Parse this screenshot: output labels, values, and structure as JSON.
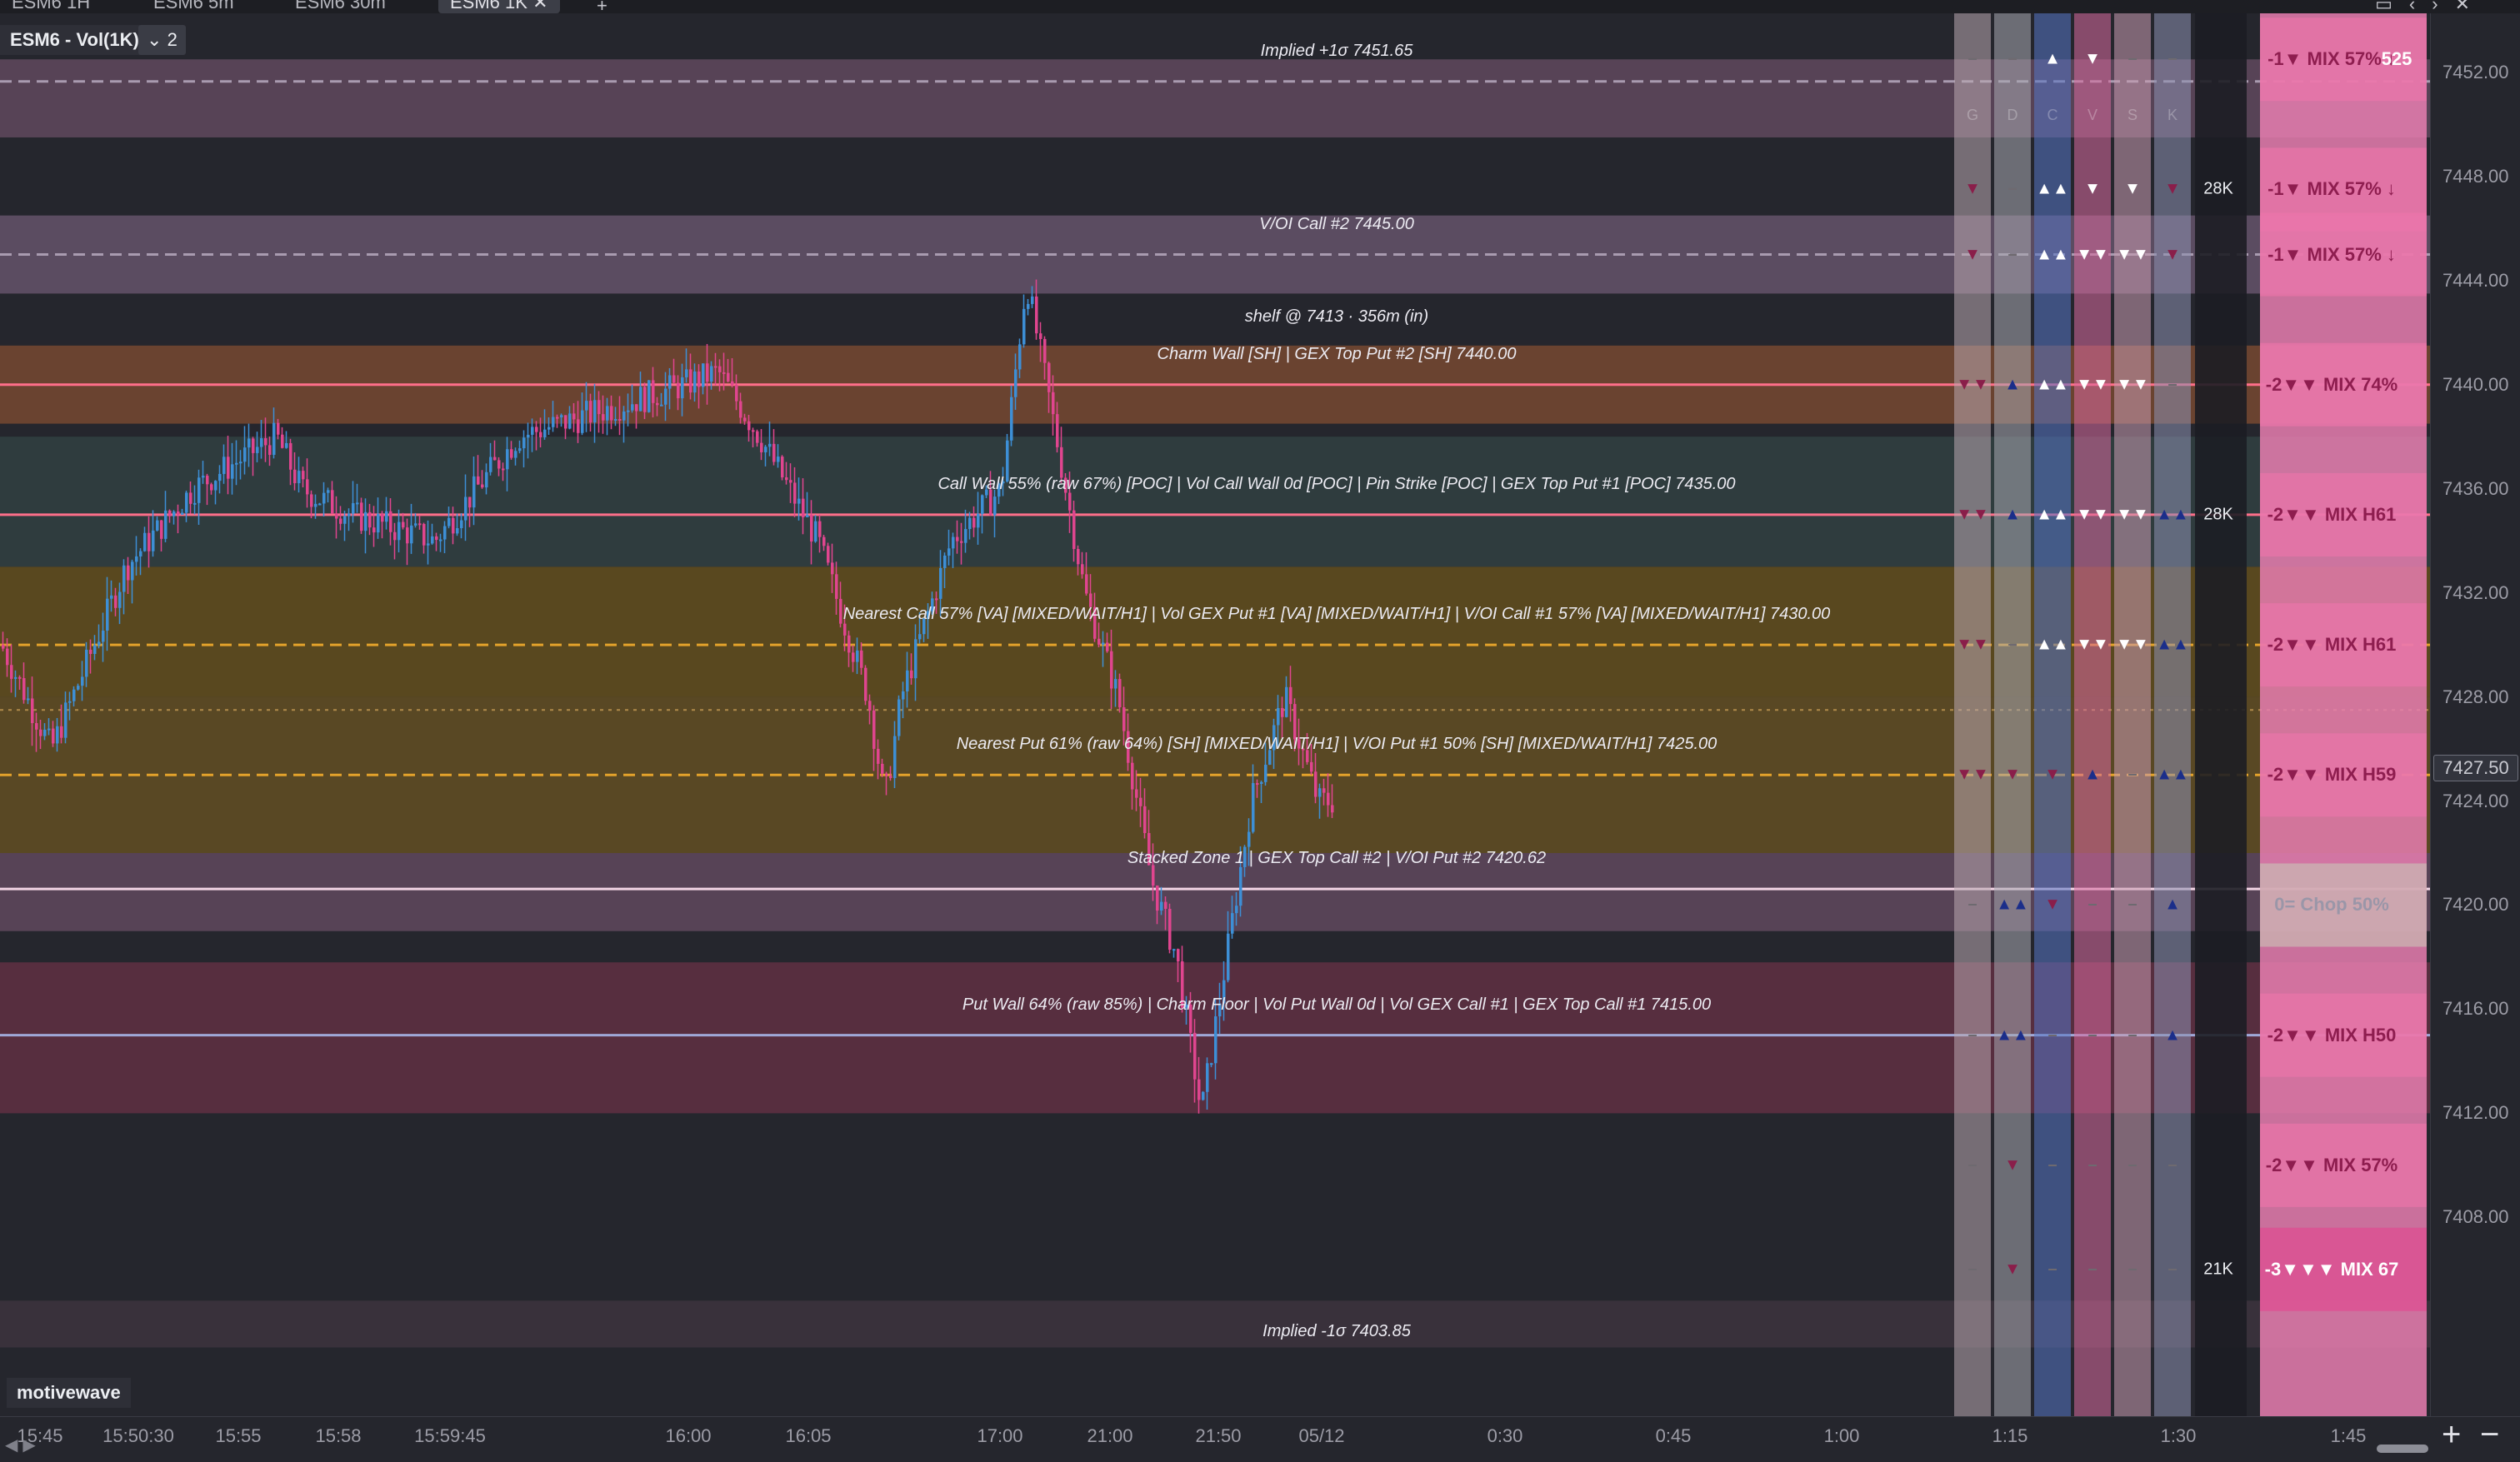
{
  "tabs": [
    {
      "label": "ESM6 1H",
      "active": false
    },
    {
      "label": "ESM6 5m",
      "active": false
    },
    {
      "label": "ESM6 30m",
      "active": false
    },
    {
      "label": "ESM6 1K",
      "active": true
    }
  ],
  "chart": {
    "symbol_label": "ESM6 - Vol(1K)",
    "layer_count": "2",
    "watermark": "motivewave",
    "current_price": "7427.50"
  },
  "colors": {
    "background": "#25262d",
    "candle_up": "#3d8fd6",
    "candle_down": "#e0458f",
    "call_line": "#ff6f8a",
    "nearest_line": "#e3a22b",
    "band_purple": "#5a4458",
    "band_orange": "#6e4530",
    "band_teal": "#2f3d3f",
    "band_gold": "#5c4a1f",
    "band_red": "#5a2e40"
  },
  "price_axis": {
    "min": 7401,
    "max": 7453.5,
    "ticks": [
      "7452.00",
      "7448.00",
      "7444.00",
      "7440.00",
      "7436.00",
      "7432.00",
      "7428.00",
      "7424.00",
      "7420.00",
      "7416.00",
      "7412.00",
      "7408.00"
    ]
  },
  "time_axis": {
    "labels": [
      "15:45",
      "15:50:30",
      "15:55",
      "15:58",
      "15:59:45",
      "16:00",
      "16:05",
      "17:00",
      "21:00",
      "21:50",
      "05/12",
      "0:30",
      "0:45",
      "1:00",
      "1:15",
      "1:30",
      "1:45"
    ]
  },
  "bands": [
    {
      "label": "Implied +1σ  7451.65",
      "price": 7451.65,
      "top": 7452.5,
      "bottom": 7449.5,
      "color": "#5a4458",
      "line": "#a99bb0",
      "dashed": true
    },
    {
      "label": "V/OI Call #2  7445.00",
      "price": 7445.0,
      "top": 7446.5,
      "bottom": 7443.5,
      "color": "#5e4e64",
      "line": "#a99bb0",
      "dashed": true
    },
    {
      "label": "shelf @ 7413 · 356m (in)",
      "price": 7442.6,
      "top": null,
      "bottom": null,
      "color": null,
      "line": null,
      "dashed": false
    },
    {
      "label": "Charm Wall [SH] | GEX Top Put #2 [SH]  7440.00",
      "price": 7440.0,
      "top": 7441.5,
      "bottom": 7438.5,
      "color": "#6e4530",
      "line": "#ff6f8a",
      "dashed": false
    },
    {
      "label": "Call Wall 55% (raw 67%) [POC] | Vol Call Wall 0d [POC] | Pin Strike [POC] | GEX Top Put #1 [POC]  7435.00",
      "price": 7435.0,
      "top": 7438.0,
      "bottom": 7433.0,
      "color": "#2f3d3f",
      "line": "#ff6f8a",
      "dashed": false
    },
    {
      "label": "Nearest Call 57% [VA] [MIXED/WAIT/H1] | Vol GEX Put #1 [VA] [MIXED/WAIT/H1] | V/OI Call #1 57% [VA] [MIXED/WAIT/H1]  7430.00",
      "price": 7430.0,
      "top": 7433.0,
      "bottom": 7428.0,
      "color": "#5c4a1f",
      "line": "#e3a22b",
      "dashed": true
    },
    {
      "label": "Nearest Put 61% (raw 64%) [SH] [MIXED/WAIT/H1] | V/OI Put #1 50% [SH] [MIXED/WAIT/H1]  7425.00",
      "price": 7425.0,
      "top": 7428.0,
      "bottom": 7422.0,
      "color": "#5c4a24",
      "line": "#e3a22b",
      "dashed": true
    },
    {
      "label": "Stacked Zone 1 | GEX Top Call #2 | V/OI Put #2  7420.62",
      "price": 7420.62,
      "top": 7422.0,
      "bottom": 7419.0,
      "color": "#5a4458",
      "line": "#f2d4e4",
      "dashed": false
    },
    {
      "label": "Put Wall 64% (raw 85%) | Charm Floor | Vol Put Wall 0d | Vol GEX Call #1 | GEX Top Call #1  7415.00",
      "price": 7415.0,
      "top": 7417.8,
      "bottom": 7412.0,
      "color": "#5a2e40",
      "line": "#9fa8d8",
      "dashed": false
    },
    {
      "label": "Implied -1σ  7403.85",
      "price": 7403.85,
      "top": 7404.8,
      "bottom": 7403.0,
      "color": "#3a323c",
      "line": null,
      "dashed": false
    }
  ],
  "matrix": {
    "columns": [
      "G",
      "D",
      "C",
      "V",
      "S",
      "K"
    ],
    "rows": [
      {
        "price": 7452.5,
        "cells": [
          "–",
          "–",
          "▲",
          "▼",
          "–",
          "–"
        ],
        "vol": "",
        "mix": "-1▼ MIX 57% ↓",
        "mix_extra": "525"
      },
      {
        "price": 7447.5,
        "cells": [
          "▼",
          "–",
          "▲▲",
          "▼",
          "▼",
          "▼"
        ],
        "vol": "28K",
        "mix": "-1▼ MIX 57% ↓",
        "mix_extra": ""
      },
      {
        "price": 7445.0,
        "cells": [
          "▼",
          "–",
          "▲▲",
          "▼▼",
          "▼▼",
          "▼"
        ],
        "vol": "",
        "mix": "-1▼ MIX 57% ↓",
        "mix_extra": ""
      },
      {
        "price": 7440.0,
        "cells": [
          "▼▼",
          "▲",
          "▲▲",
          "▼▼",
          "▼▼",
          "–"
        ],
        "vol": "",
        "mix": "-2▼▼ MIX 74%",
        "mix_extra": ""
      },
      {
        "price": 7435.0,
        "cells": [
          "▼▼",
          "▲",
          "▲▲",
          "▼▼",
          "▼▼",
          "▲▲"
        ],
        "vol": "28K",
        "mix": "-2▼▼ MIX H61",
        "mix_extra": ""
      },
      {
        "price": 7430.0,
        "cells": [
          "▼▼",
          "–",
          "▲▲",
          "▼▼",
          "▼▼",
          "▲▲"
        ],
        "vol": "",
        "mix": "-2▼▼ MIX H61",
        "mix_extra": ""
      },
      {
        "price": 7425.0,
        "cells": [
          "▼▼",
          "▼",
          "▼",
          "▲",
          "–",
          "▲▲"
        ],
        "vol": "",
        "mix": "-2▼▼ MIX H59",
        "mix_extra": ""
      },
      {
        "price": 7420.0,
        "cells": [
          "–",
          "▲▲",
          "▼",
          "–",
          "–",
          "▲"
        ],
        "vol": "",
        "mix": "0= Chop 50%",
        "mix_extra": ""
      },
      {
        "price": 7415.0,
        "cells": [
          "–",
          "▲▲",
          "–",
          "–",
          "–",
          "▲"
        ],
        "vol": "",
        "mix": "-2▼▼ MIX H50",
        "mix_extra": ""
      },
      {
        "price": 7410.0,
        "cells": [
          "–",
          "▼",
          "–",
          "–",
          "–",
          "–"
        ],
        "vol": "",
        "mix": "-2▼▼ MIX 57%",
        "mix_extra": ""
      },
      {
        "price": 7406.0,
        "cells": [
          "–",
          "▼",
          "–",
          "–",
          "–",
          "–"
        ],
        "vol": "21K",
        "mix": "-3▼▼▼ MIX 67",
        "mix_extra": ""
      }
    ]
  }
}
